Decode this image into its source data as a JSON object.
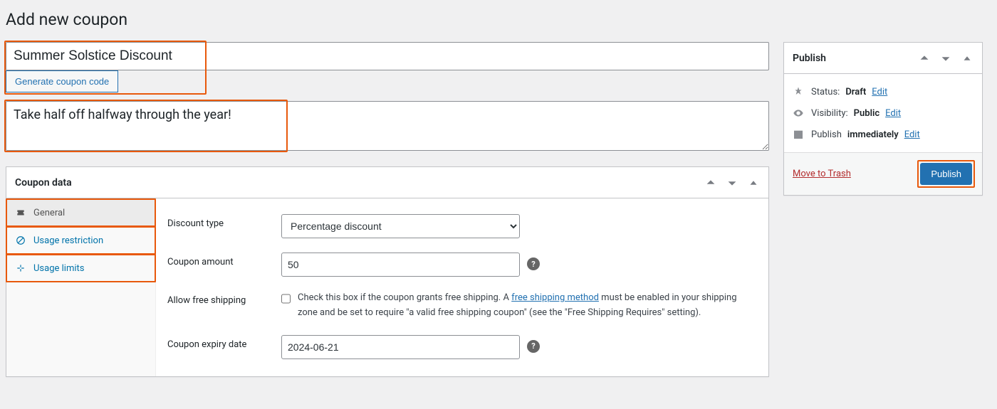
{
  "page_title": "Add new coupon",
  "coupon": {
    "title_value": "Summer Solstice Discount",
    "generate_label": "Generate coupon code",
    "description_value": "Take half off halfway through the year!"
  },
  "coupon_data": {
    "box_title": "Coupon data",
    "tabs": {
      "general": "General",
      "usage_restriction": "Usage restriction",
      "usage_limits": "Usage limits"
    },
    "fields": {
      "discount_type_label": "Discount type",
      "discount_type_value": "Percentage discount",
      "coupon_amount_label": "Coupon amount",
      "coupon_amount_value": "50",
      "free_shipping_label": "Allow free shipping",
      "free_shipping_checked": false,
      "free_shipping_desc_pre": "Check this box if the coupon grants free shipping. A ",
      "free_shipping_link": "free shipping method",
      "free_shipping_desc_post": " must be enabled in your shipping zone and be set to require \"a valid free shipping coupon\" (see the \"Free Shipping Requires\" setting).",
      "expiry_label": "Coupon expiry date",
      "expiry_value": "2024-06-21"
    }
  },
  "publish": {
    "box_title": "Publish",
    "status_label": "Status:",
    "status_value": "Draft",
    "visibility_label": "Visibility:",
    "visibility_value": "Public",
    "schedule_label": "Publish",
    "schedule_value": "immediately",
    "edit_link": "Edit",
    "trash_label": "Move to Trash",
    "publish_button": "Publish"
  }
}
